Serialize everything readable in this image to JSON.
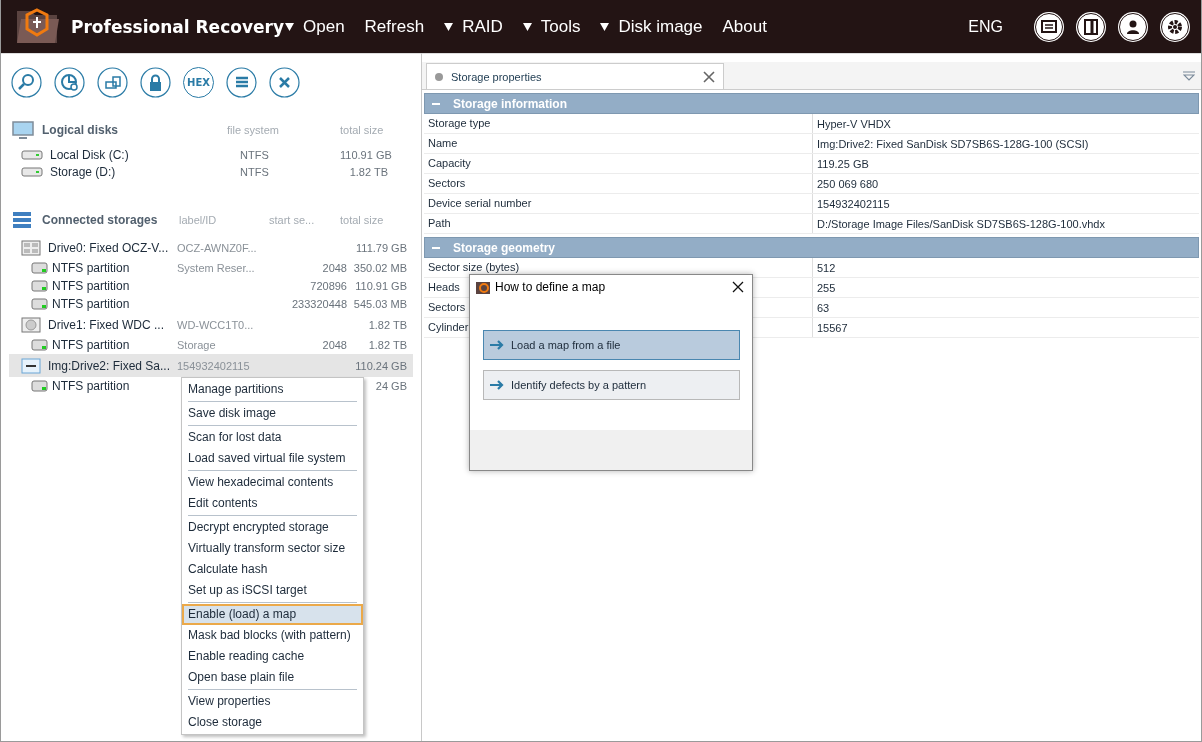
{
  "app": {
    "title": "Professional Recovery",
    "language": "ENG"
  },
  "menu": [
    {
      "label": "Open",
      "dropdown": true
    },
    {
      "label": "Refresh",
      "dropdown": false
    },
    {
      "label": "RAID",
      "dropdown": true
    },
    {
      "label": "Tools",
      "dropdown": true
    },
    {
      "label": "Disk image",
      "dropdown": true
    },
    {
      "label": "About",
      "dropdown": false
    }
  ],
  "toolbar": [
    {
      "kind": "search"
    },
    {
      "kind": "chart"
    },
    {
      "kind": "image"
    },
    {
      "kind": "lock"
    },
    {
      "kind": "hex",
      "label": "HEX"
    },
    {
      "kind": "list"
    },
    {
      "kind": "close"
    }
  ],
  "logical_disks": {
    "title": "Logical disks",
    "columns": [
      "file system",
      "total size"
    ],
    "rows": [
      {
        "name": "Local Disk (C:)",
        "file_system": "NTFS",
        "total_size": "110.91 GB"
      },
      {
        "name": "Storage (D:)",
        "file_system": "NTFS",
        "total_size": "1.82 TB"
      }
    ]
  },
  "connected_storages": {
    "title": "Connected storages",
    "columns": [
      "label/ID",
      "start se...",
      "total size"
    ],
    "items": [
      {
        "kind": "ssd",
        "name": "Drive0: Fixed OCZ-V...",
        "label": "OCZ-AWNZ0F...",
        "total_size": "111.79 GB",
        "selected": false,
        "children": [
          {
            "kind": "partition",
            "name": "NTFS partition",
            "label": "System Reser...",
            "start": "2048",
            "total_size": "350.02 MB"
          },
          {
            "kind": "partition",
            "name": "NTFS partition",
            "start": "720896",
            "total_size": "110.91 GB"
          },
          {
            "kind": "partition",
            "name": "NTFS partition",
            "start": "233320448",
            "total_size": "545.03 MB"
          }
        ]
      },
      {
        "kind": "hdd",
        "name": "Drive1: Fixed WDC ...",
        "label": "WD-WCC1T0...",
        "total_size": "1.82 TB",
        "selected": false,
        "children": [
          {
            "kind": "partition",
            "name": "NTFS partition",
            "label": "Storage",
            "start": "2048",
            "total_size": "1.82 TB"
          }
        ]
      },
      {
        "kind": "image",
        "name": "Img:Drive2: Fixed Sa...",
        "label": "154932402115",
        "total_size": "110.24 GB",
        "selected": true,
        "children": [
          {
            "kind": "partition",
            "name": "NTFS partition",
            "total_size": "24 GB"
          }
        ]
      }
    ]
  },
  "context_menu": [
    [
      {
        "label": "Manage partitions",
        "selected": false
      }
    ],
    [
      {
        "label": "Save disk image",
        "selected": false
      }
    ],
    [
      {
        "label": "Scan for lost data",
        "selected": false
      },
      {
        "label": "Load saved virtual file system",
        "selected": false
      }
    ],
    [
      {
        "label": "View hexadecimal contents",
        "selected": false
      },
      {
        "label": "Edit contents",
        "selected": false
      }
    ],
    [
      {
        "label": "Decrypt encrypted storage",
        "selected": false
      },
      {
        "label": "Virtually transform sector size",
        "selected": false
      },
      {
        "label": "Calculate hash",
        "selected": false
      },
      {
        "label": "Set up as iSCSI target",
        "selected": false
      }
    ],
    [
      {
        "label": "Enable (load) a map",
        "selected": true
      },
      {
        "label": "Mask bad blocks (with pattern)",
        "selected": false
      },
      {
        "label": "Enable reading cache",
        "selected": false
      },
      {
        "label": "Open base plain file",
        "selected": false
      }
    ],
    [
      {
        "label": "View properties",
        "selected": false
      },
      {
        "label": "Close storage",
        "selected": false
      }
    ]
  ],
  "tabs": [
    {
      "label": "Storage properties",
      "selected": true
    }
  ],
  "properties": [
    {
      "title": "Storage information",
      "expanded": true,
      "rows": [
        [
          "Storage type",
          "Hyper-V VHDX"
        ],
        [
          "Name",
          "Img:Drive2: Fixed SanDisk SD7SB6S-128G-100 (SCSI)"
        ],
        [
          "Capacity",
          "119.25 GB"
        ],
        [
          "Sectors",
          "250 069 680"
        ],
        [
          "Device serial number",
          "154932402115"
        ],
        [
          "Path",
          "D:/Storage Image Files/SanDisk SD7SB6S-128G-100.vhdx"
        ]
      ]
    },
    {
      "title": "Storage geometry",
      "expanded": true,
      "rows": [
        [
          "Sector size (bytes)",
          "512"
        ],
        [
          "Heads",
          "255"
        ],
        [
          "Sectors",
          "63"
        ],
        [
          "Cylinder",
          "15567"
        ]
      ]
    }
  ],
  "dialog": {
    "title": "How to define a map",
    "options": [
      {
        "label": "Load a map from a file",
        "selected": true
      },
      {
        "label": "Identify defects by a pattern",
        "selected": false
      }
    ]
  }
}
